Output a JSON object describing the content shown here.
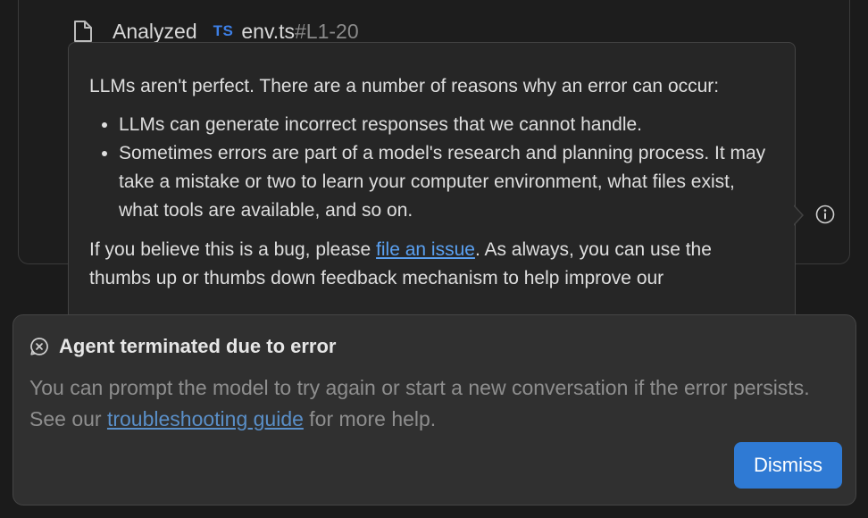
{
  "step": {
    "status": "Analyzed",
    "lang_badge": "TS",
    "file_name": "env.ts",
    "line_range": "#L1-20",
    "icon": "file-icon"
  },
  "tooltip": {
    "intro": "LLMs aren't perfect. There are a number of reasons why an error can occur:",
    "bullets": [
      "LLMs can generate incorrect responses that we cannot handle.",
      "Sometimes errors are part of a model's research and planning process. It may take a mistake or two to learn your computer environment, what files exist, what tools are available, and so on."
    ],
    "bug_prefix": "If you believe this is a bug, please ",
    "bug_link": "file an issue",
    "bug_suffix": ". As always, you can use the thumbs up or thumbs down feedback mechanism to help improve our"
  },
  "info_icon": "info-icon",
  "error": {
    "icon": "error-circle-icon",
    "title": "Agent terminated due to error",
    "body_prefix": "You can prompt the model to try again or start a new conversation if the error persists. See our ",
    "body_link": "troubleshooting guide",
    "body_suffix": " for more help.",
    "dismiss_label": "Dismiss"
  },
  "colors": {
    "background": "#1b1b1b",
    "panel": "#303030",
    "tooltip": "#262626",
    "accent": "#2f7ad4",
    "link": "#5aa0f0",
    "ts_badge": "#3d7fe6"
  }
}
